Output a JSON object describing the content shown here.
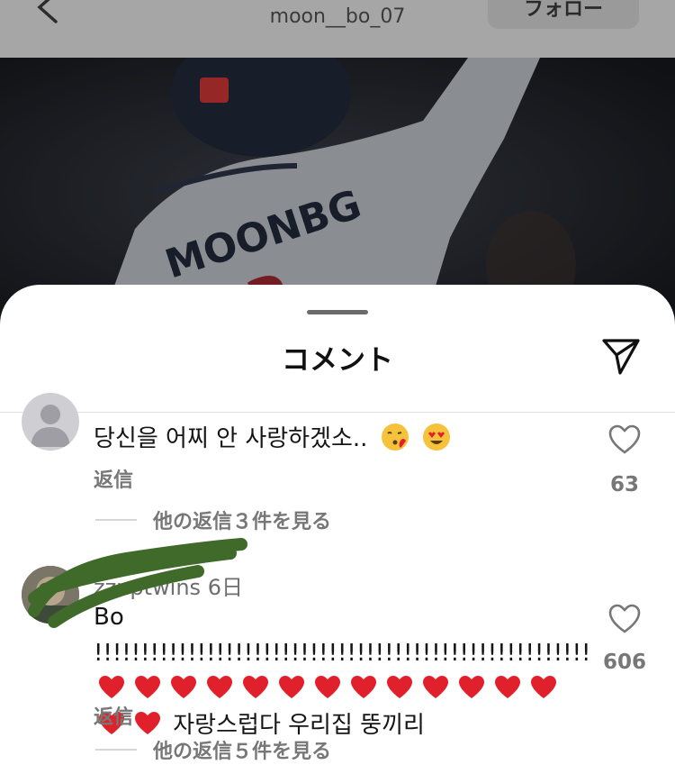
{
  "header": {
    "username": "moon__bo_07",
    "follow_label": "フォロー"
  },
  "sheet": {
    "title": "コメント"
  },
  "comments": [
    {
      "text": "당신을 어찌 안 사랑하겠소..",
      "reply_label": "返信",
      "like_count": "63",
      "view_replies_label": "他の返信３件を見る"
    },
    {
      "username": "zzuptwins 6日",
      "text_prefix": "Bo !!!!!!!!!!!!!!!!!!!!!!!!!!!!!!!!!!!!!!!!!!!!!!!!!!!!!",
      "text_suffix": "자랑스럽다 우리집 뚱끼리",
      "reply_label": "返信",
      "like_count": "606",
      "view_replies_label": "他の返信５件を見る"
    }
  ],
  "colors": {
    "header_dim": "#a6a6a6",
    "sheet_bg": "#ffffff",
    "secondary_text": "#777777",
    "heart_red": "#e0202a",
    "scribble_green": "#3f6a2a"
  },
  "icons": [
    "back-chevron-icon",
    "share-send-icon",
    "like-heart-icon",
    "red-heart-emoji",
    "kissing-face-emoji",
    "heart-eyes-emoji",
    "default-avatar-icon"
  ]
}
